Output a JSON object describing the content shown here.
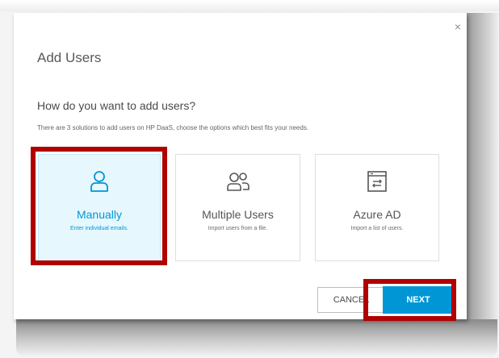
{
  "dialog": {
    "title": "Add Users",
    "close_glyph": "×",
    "question": "How do you want to add users?",
    "description": "There are 3 solutions to add users on HP DaaS, choose the options which best fits your needs."
  },
  "options": [
    {
      "label": "Manually",
      "sub": "Enter individual emails.",
      "icon": "user-icon",
      "selected": true
    },
    {
      "label": "Multiple Users",
      "sub": "Import users from a file.",
      "icon": "users-group-icon",
      "selected": false
    },
    {
      "label": "Azure AD",
      "sub": "Import a list of users.",
      "icon": "azure-directory-icon",
      "selected": false
    }
  ],
  "buttons": {
    "cancel": "CANCEL",
    "next": "NEXT"
  },
  "colors": {
    "accent": "#0096d6",
    "selected_background": "#e6f8fe",
    "highlight_border": "#b00000"
  }
}
